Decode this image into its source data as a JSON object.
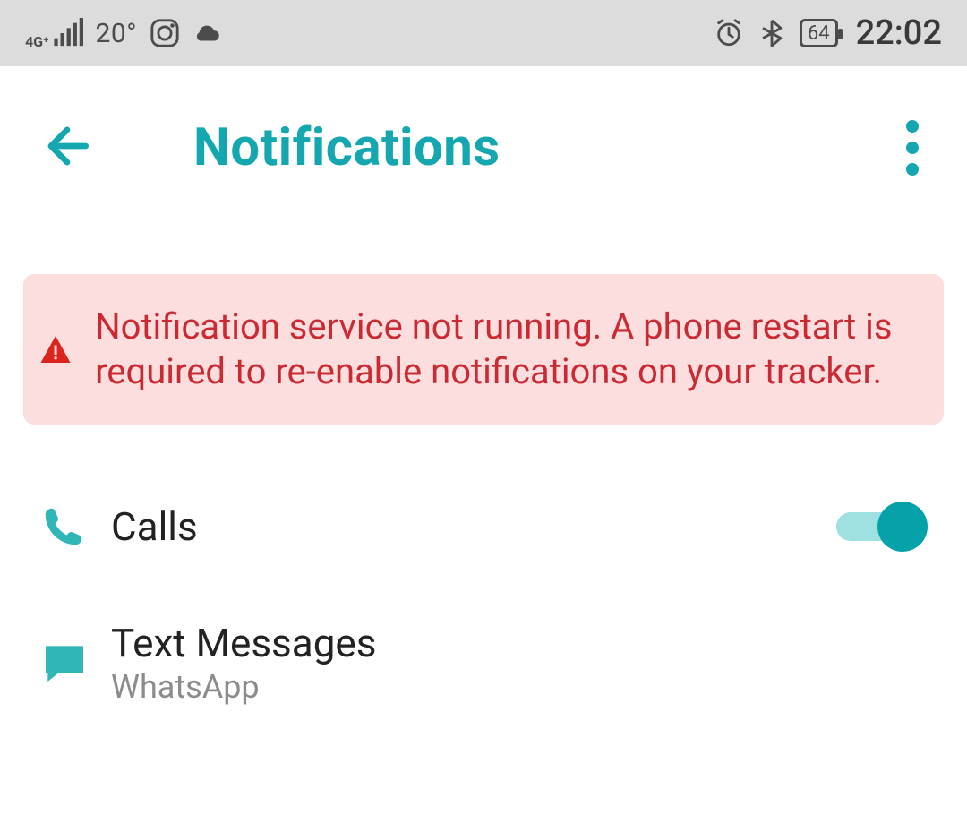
{
  "status_bar": {
    "network_label": "4G⁺",
    "temperature": "20°",
    "battery_percent": "64",
    "time": "22:02"
  },
  "header": {
    "title": "Notifications"
  },
  "alert": {
    "message": "Notification service not running. A phone restart is required to re-enable notifications on your tracker."
  },
  "rows": {
    "calls": {
      "title": "Calls",
      "enabled": true
    },
    "text_messages": {
      "title": "Text Messages",
      "subtitle": "WhatsApp"
    }
  }
}
